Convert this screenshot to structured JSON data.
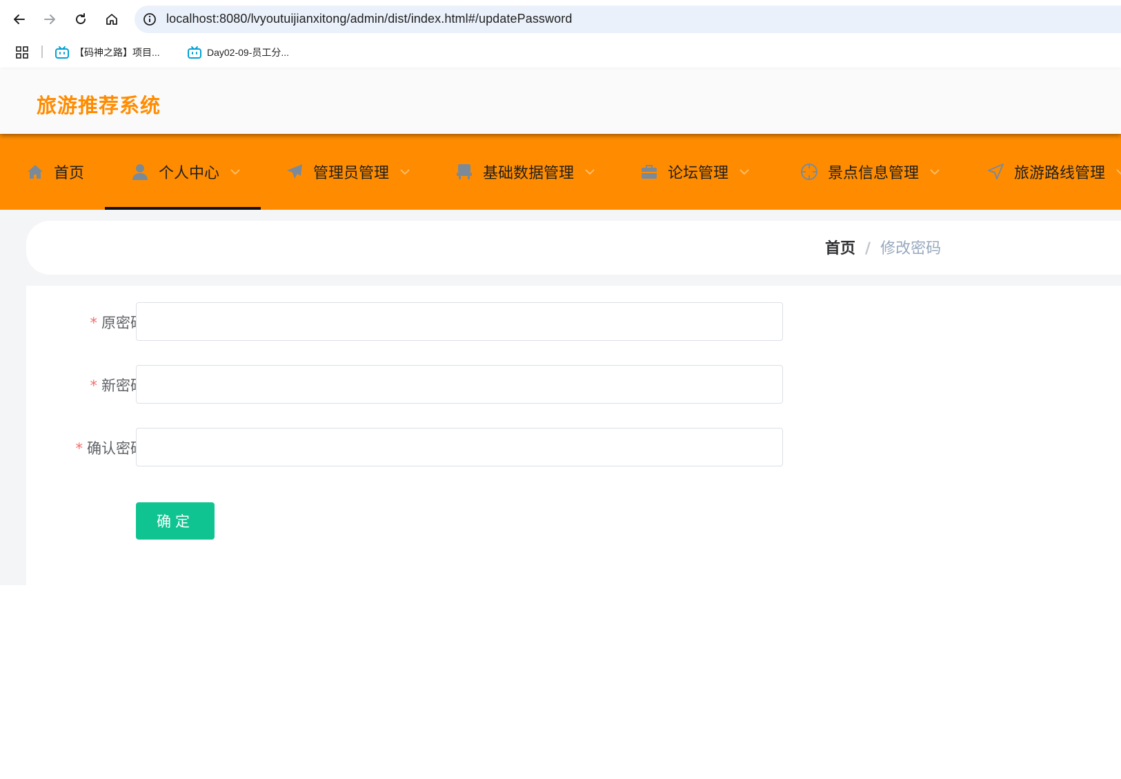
{
  "browser": {
    "url": "localhost:8080/lvyoutuijianxitong/admin/dist/index.html#/updatePassword",
    "bookmarks": [
      {
        "label": "【码神之路】项目..."
      },
      {
        "label": "Day02-09-员工分..."
      }
    ]
  },
  "app": {
    "title": "旅游推荐系统"
  },
  "nav": {
    "items": [
      {
        "label": "首页",
        "icon": "home-icon"
      },
      {
        "label": "个人中心",
        "icon": "user-icon"
      },
      {
        "label": "管理员管理",
        "icon": "send-icon"
      },
      {
        "label": "基础数据管理",
        "icon": "chair-icon"
      },
      {
        "label": "论坛管理",
        "icon": "briefcase-icon"
      },
      {
        "label": "景点信息管理",
        "icon": "target-icon"
      },
      {
        "label": "旅游路线管理",
        "icon": "navigation-icon"
      }
    ],
    "active": "个人中心"
  },
  "breadcrumb": {
    "home": "首页",
    "separator": "/",
    "current": "修改密码"
  },
  "form": {
    "required_mark": "*",
    "old_password_label": "原密码",
    "new_password_label": "新密码",
    "confirm_password_label": "确认密码",
    "old_password_value": "",
    "new_password_value": "",
    "confirm_password_value": "",
    "submit_label": "确定"
  },
  "colors": {
    "brand": "#ff8c00",
    "submit": "#0fc491",
    "required": "#f56c6c"
  }
}
